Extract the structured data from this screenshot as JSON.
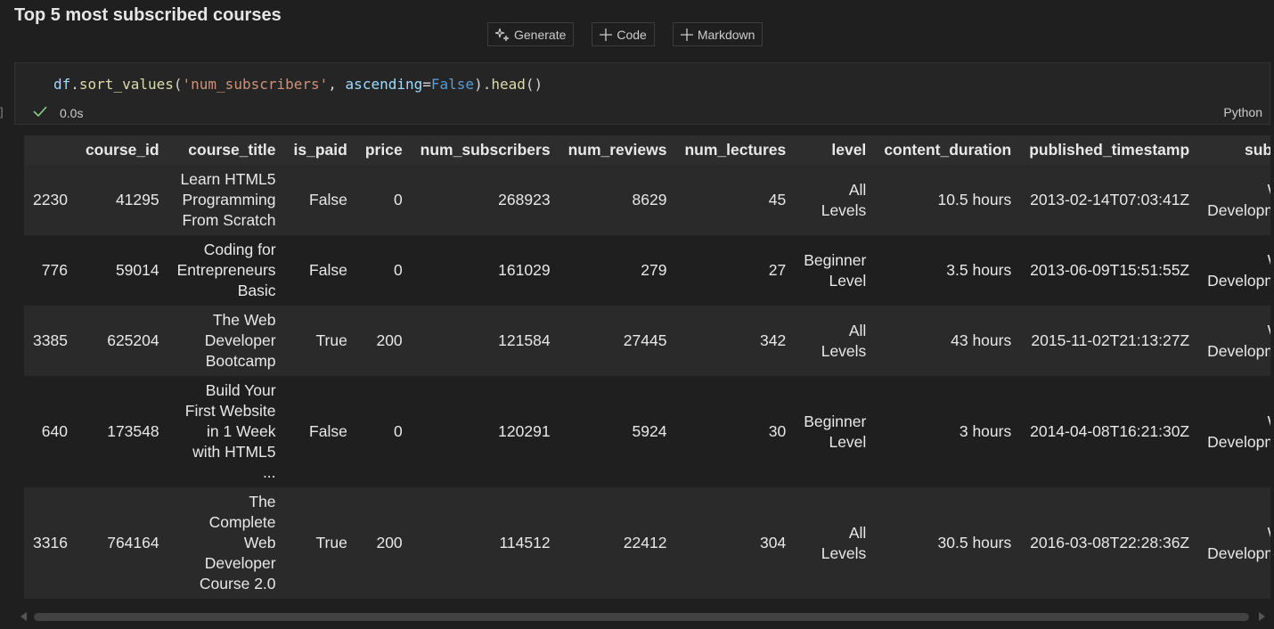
{
  "heading": "Top 5 most subscribed courses",
  "toolbar": {
    "generate_label": "Generate",
    "code_label": "Code",
    "markdown_label": "Markdown"
  },
  "cell": {
    "exec_count": "]",
    "status_time": "0.0s",
    "language": "Python",
    "code_tokens": [
      "df",
      ".",
      "sort_values",
      "(",
      "'num_subscribers'",
      ", ",
      "ascending",
      "=",
      "False",
      ")",
      ".",
      "head",
      "()"
    ]
  },
  "table": {
    "columns": [
      "",
      "course_id",
      "course_title",
      "is_paid",
      "price",
      "num_subscribers",
      "num_reviews",
      "num_lectures",
      "level",
      "content_duration",
      "published_timestamp",
      "subject"
    ],
    "rows": [
      [
        "2230",
        "41295",
        "Learn HTML5\nProgramming\nFrom Scratch",
        "False",
        "0",
        "268923",
        "8629",
        "45",
        "All\nLevels",
        "10.5 hours",
        "2013-02-14T07:03:41Z",
        "Web\nDevelopment"
      ],
      [
        "776",
        "59014",
        "Coding for\nEntrepreneurs\nBasic",
        "False",
        "0",
        "161029",
        "279",
        "27",
        "Beginner\nLevel",
        "3.5 hours",
        "2013-06-09T15:51:55Z",
        "Web\nDevelopment"
      ],
      [
        "3385",
        "625204",
        "The Web\nDeveloper\nBootcamp",
        "True",
        "200",
        "121584",
        "27445",
        "342",
        "All\nLevels",
        "43 hours",
        "2015-11-02T21:13:27Z",
        "Web\nDevelopment"
      ],
      [
        "640",
        "173548",
        "Build Your\nFirst Website\nin 1 Week\nwith HTML5\n...",
        "False",
        "0",
        "120291",
        "5924",
        "30",
        "Beginner\nLevel",
        "3 hours",
        "2014-04-08T16:21:30Z",
        "Web\nDevelopment"
      ],
      [
        "3316",
        "764164",
        "The\nComplete\nWeb\nDeveloper\nCourse 2.0",
        "True",
        "200",
        "114512",
        "22412",
        "304",
        "All\nLevels",
        "30.5 hours",
        "2016-03-08T22:28:36Z",
        "Web\nDevelopment"
      ]
    ]
  },
  "colors": {
    "check": "#89d185",
    "background": "#1f1f1f"
  }
}
